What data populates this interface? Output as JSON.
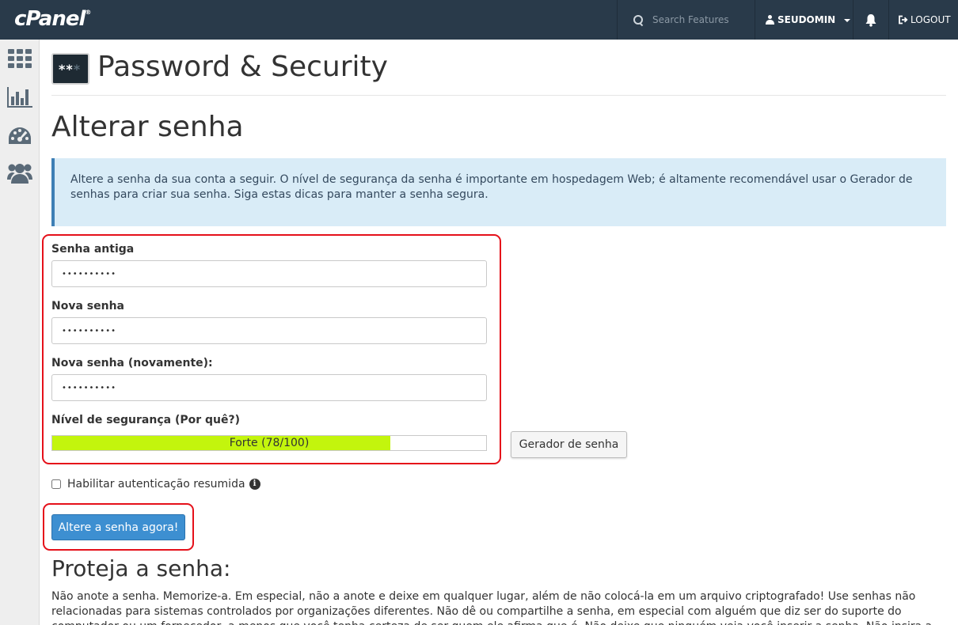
{
  "topbar": {
    "logo": "cPanel",
    "logo_mark": "®",
    "search_placeholder": "Search Features",
    "username": "SEUDOMIN",
    "logout_label": "LOGOUT"
  },
  "sidebar": {
    "items": [
      {
        "icon": "grid-icon"
      },
      {
        "icon": "bar-chart-icon"
      },
      {
        "icon": "dashboard-gauge-icon"
      },
      {
        "icon": "users-icon"
      }
    ]
  },
  "page": {
    "title": "Password & Security",
    "icon_text_bright": "**",
    "icon_text_dim": "*"
  },
  "section": {
    "title": "Alterar senha",
    "info": "Altere a senha da sua conta a seguir. O nível de segurança da senha é importante em hospedagem Web; é altamente recomendável usar o Gerador de senhas para criar sua senha. Siga estas dicas para manter a senha segura."
  },
  "form": {
    "old_password_label": "Senha antiga",
    "old_password_value": "••••••••••",
    "new_password_label": "Nova senha",
    "new_password_value": "••••••••••",
    "confirm_password_label": "Nova senha (novamente):",
    "confirm_password_value": "••••••••••",
    "strength_label": "Nível de segurança (Por quê?)",
    "strength_text": "Forte (78/100)",
    "strength_value": 78,
    "strength_color": "#c3f50d",
    "generator_button": "Gerador de senha",
    "digest_auth_label": "Habilitar autenticação resumida",
    "digest_auth_checked": false,
    "submit_button": "Altere a senha agora!"
  },
  "protect": {
    "title": "Proteja a senha:",
    "text": "Não anote a senha. Memorize-a. Em especial, não a anote e deixe em qualquer lugar, além de não colocá-la em um arquivo criptografado! Use senhas não relacionadas para sistemas controlados por organizações diferentes. Não dê ou compartilhe a senha, em especial com alguém que diz ser do suporte do computador ou um fornecedor, a menos que você tenha certeza de ser quem ele afirma que é. Não deixe que ninguém veja você inserir a senha. Não insira a senha em um computador"
  },
  "colors": {
    "topbar": "#293a4a",
    "primary": "#3d8fd1",
    "highlight": "#e5101a",
    "info_bg": "#d9ecf7"
  }
}
